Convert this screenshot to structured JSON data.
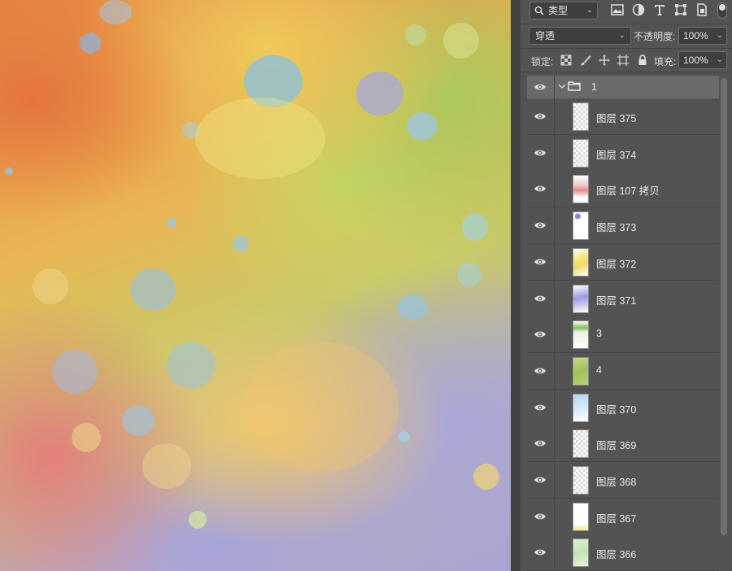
{
  "layers_panel": {
    "filter": {
      "label": "类型"
    },
    "blend_mode": "穿透",
    "opacity_label": "不透明度:",
    "opacity_value": "100%",
    "lock_label": "锁定:",
    "fill_label": "填充:",
    "fill_value": "100%",
    "group": {
      "name": "1",
      "expanded": true
    },
    "layers": [
      {
        "name": "图层 375",
        "thumb": "empty"
      },
      {
        "name": "图层 374",
        "thumb": "empty"
      },
      {
        "name": "图层 107 拷贝",
        "thumb": "red"
      },
      {
        "name": "图层 373",
        "thumb": "purple-dots"
      },
      {
        "name": "图层 372",
        "thumb": "yellow"
      },
      {
        "name": "图层 371",
        "thumb": "blue"
      },
      {
        "name": "3",
        "thumb": "green-top"
      },
      {
        "name": "4",
        "thumb": "green"
      },
      {
        "name": "图层 370",
        "thumb": "lightblue"
      },
      {
        "name": "图层 369",
        "thumb": "empty"
      },
      {
        "name": "图层 368",
        "thumb": "empty"
      },
      {
        "name": "图层 367",
        "thumb": "empty-yellow-bottom"
      },
      {
        "name": "图层 366",
        "thumb": "green-light"
      }
    ]
  },
  "colors": {
    "panel_bg": "#535353",
    "selected_row": "#6a6a6a"
  }
}
